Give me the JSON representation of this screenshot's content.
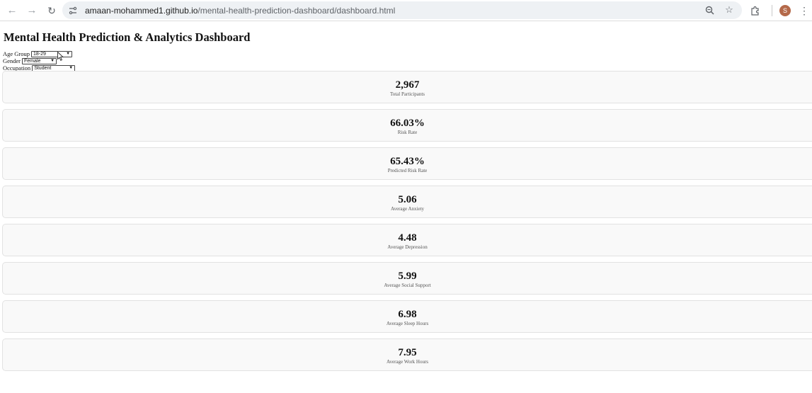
{
  "browser": {
    "url_host": "amaan-mohammed1.github.io",
    "url_path": "/mental-health-prediction-dashboard/dashboard.html",
    "profile_initial": "S",
    "icons": {
      "back": "back-arrow-icon",
      "forward": "forward-arrow-icon",
      "reload": "reload-icon",
      "site_info": "site-info-icon",
      "zoom": "zoom-icon",
      "bookmark": "star-icon",
      "extensions": "puzzle-icon",
      "menu": "kebab-menu-icon"
    }
  },
  "page": {
    "title": "Mental Health Prediction & Analytics Dashboard"
  },
  "filters": {
    "age_group": {
      "label": "Age Group",
      "selected": "18-29"
    },
    "gender": {
      "label": "Gender",
      "selected": "Female"
    },
    "occupation": {
      "label": "Occupation",
      "selected": "Student"
    }
  },
  "cards": [
    {
      "value": "2,967",
      "label": "Total Participants"
    },
    {
      "value": "66.03%",
      "label": "Risk Rate"
    },
    {
      "value": "65.43%",
      "label": "Predicted Risk Rate"
    },
    {
      "value": "5.06",
      "label": "Average Anxiety"
    },
    {
      "value": "4.48",
      "label": "Average Depression"
    },
    {
      "value": "5.99",
      "label": "Average Social Support"
    },
    {
      "value": "6.98",
      "label": "Average Sleep Hours"
    },
    {
      "value": "7.95",
      "label": "Average Work Hours"
    }
  ]
}
